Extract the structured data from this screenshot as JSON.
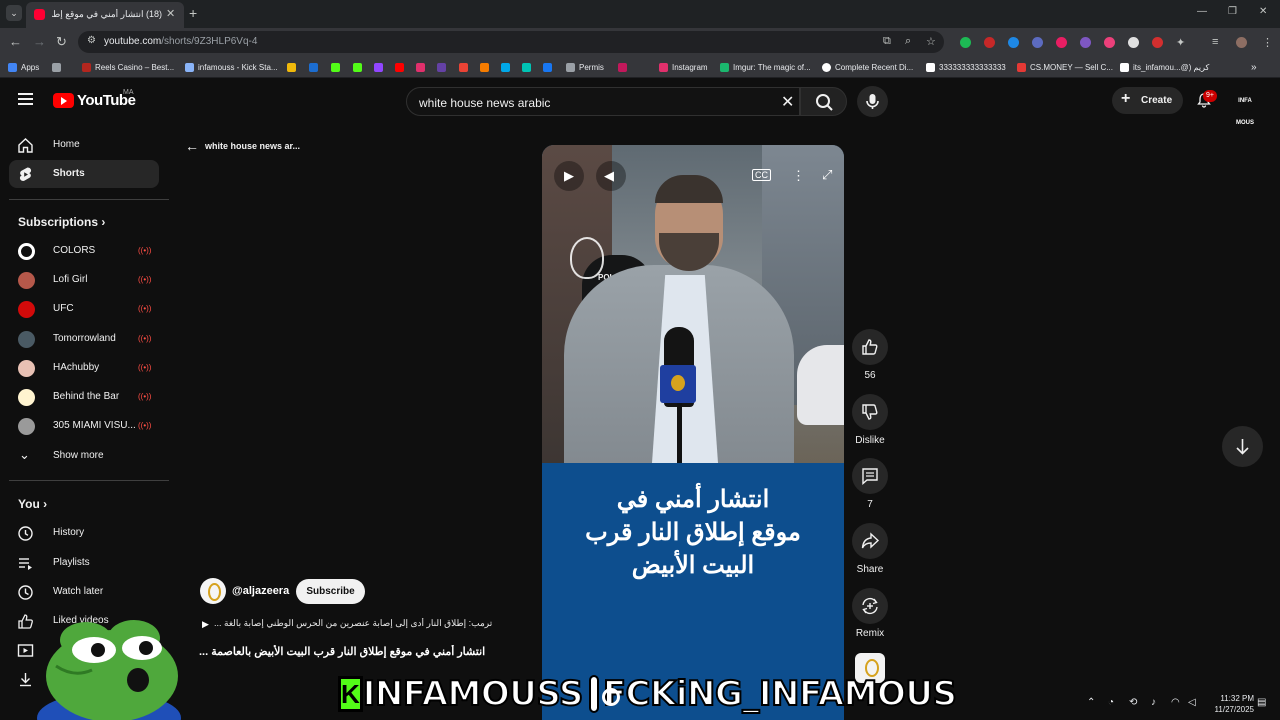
{
  "browser": {
    "tab_title": "(18) انتشار أمني في موقع إطلاق",
    "tab_close": "✕",
    "new_tab": "+",
    "tab_list": "⌄",
    "url_host": "youtube.com",
    "url_path": "/shorts/9Z3HLP6Vq-4",
    "window_controls": [
      "—",
      "❐",
      "✕"
    ],
    "nav": {
      "back": "←",
      "forward": "→",
      "reload": "↻"
    }
  },
  "bookmarks": [
    {
      "label": "Apps",
      "color": "#4285f4"
    },
    {
      "label": "",
      "color": "#9aa0a6"
    },
    {
      "label": "Reels Casino – Best...",
      "color": "#b3261e"
    },
    {
      "label": "infamouss - Kick Sta...",
      "color": "#8ab4f8"
    },
    {
      "label": "",
      "color": "#f0b90b"
    },
    {
      "label": "",
      "color": "#1c6dd0"
    },
    {
      "label": "",
      "color": "#53fc18"
    },
    {
      "label": "",
      "color": "#53fc18"
    },
    {
      "label": "",
      "color": "#9146ff"
    },
    {
      "label": "",
      "color": "#ff0000"
    },
    {
      "label": "",
      "color": "#e1306c"
    },
    {
      "label": "",
      "color": "#6441a5"
    },
    {
      "label": "",
      "color": "#ea4335"
    },
    {
      "label": "",
      "color": "#f57c00"
    },
    {
      "label": "",
      "color": "#00a8e8"
    },
    {
      "label": "",
      "color": "#00c4b4"
    },
    {
      "label": "",
      "color": "#1877f2"
    },
    {
      "label": "Permis",
      "color": "#9aa0a6"
    },
    {
      "label": "",
      "color": "#c2185b"
    },
    {
      "label": "Instagram",
      "color": "#e1306c"
    },
    {
      "label": "Imgur: The magic of...",
      "color": "#1bb76e"
    },
    {
      "label": "Complete Recent Di...",
      "color": "#ffffff"
    },
    {
      "label": "333333333333333",
      "color": "#ffffff"
    },
    {
      "label": "CS.MONEY — Sell C...",
      "color": "#e53935"
    },
    {
      "label": "its_infamou...@) كريم",
      "color": "#ffffff"
    }
  ],
  "youtube": {
    "wordmark": "YouTube",
    "region": "MA",
    "search_query": "white house news arabic",
    "search_clear": "✕",
    "create_label": "Create",
    "create_plus": "+",
    "notif_count": "9+",
    "avatar_text": "INFA MOUS"
  },
  "sidebar": {
    "main": [
      {
        "label": "Home",
        "icon": "home-icon",
        "active": false
      },
      {
        "label": "Shorts",
        "icon": "shorts-icon",
        "active": true
      }
    ],
    "subscriptions_title": "Subscriptions",
    "subscriptions": [
      {
        "label": "COLORS",
        "color": "#ffffff"
      },
      {
        "label": "Lofi Girl",
        "color": "#b5584a"
      },
      {
        "label": "UFC",
        "color": "#d20a0a"
      },
      {
        "label": "Tomorrowland",
        "color": "#4a5a64"
      },
      {
        "label": "HAchubby",
        "color": "#e8c1b4"
      },
      {
        "label": "Behind the Bar",
        "color": "#fff4d0"
      },
      {
        "label": "305 MIAMI VISU...",
        "color": "#9a9a9a"
      }
    ],
    "show_more": "Show more",
    "you_title": "You",
    "you": [
      {
        "label": "History",
        "icon": "history-icon"
      },
      {
        "label": "Playlists",
        "icon": "playlists-icon"
      },
      {
        "label": "Watch later",
        "icon": "watch-later-icon"
      },
      {
        "label": "Liked videos",
        "icon": "like-icon"
      },
      {
        "label": "",
        "icon": "your-videos-icon"
      },
      {
        "label": "",
        "icon": "downloads-icon"
      }
    ]
  },
  "shorts": {
    "back_label": "white house news ar...",
    "video_caption_lines": [
      "انتشار أمني في",
      "موقع إطلاق النار قرب",
      "البيت الأبيض"
    ],
    "officer_label": "POLICE",
    "channel": "@aljazeera",
    "subscribe": "Subscribe",
    "description": "ترمب: إطلاق النار أدى إلى إصابة عنصرين من الحرس الوطني إصابة بالغة ...",
    "title": "انتشار أمني في موقع إطلاق النار قرب البيت الأبيض بالعاصمة ...",
    "actions": {
      "likes": "56",
      "dislike": "Dislike",
      "comments": "7",
      "share": "Share",
      "remix": "Remix"
    }
  },
  "overlay": {
    "kick_letter": "K",
    "kick_name": "INFAMOUSS",
    "ig_name": "FCKiNG_INFAMOUS"
  },
  "taskbar": {
    "time": "11:32 PM",
    "date": "11/27/2025"
  }
}
